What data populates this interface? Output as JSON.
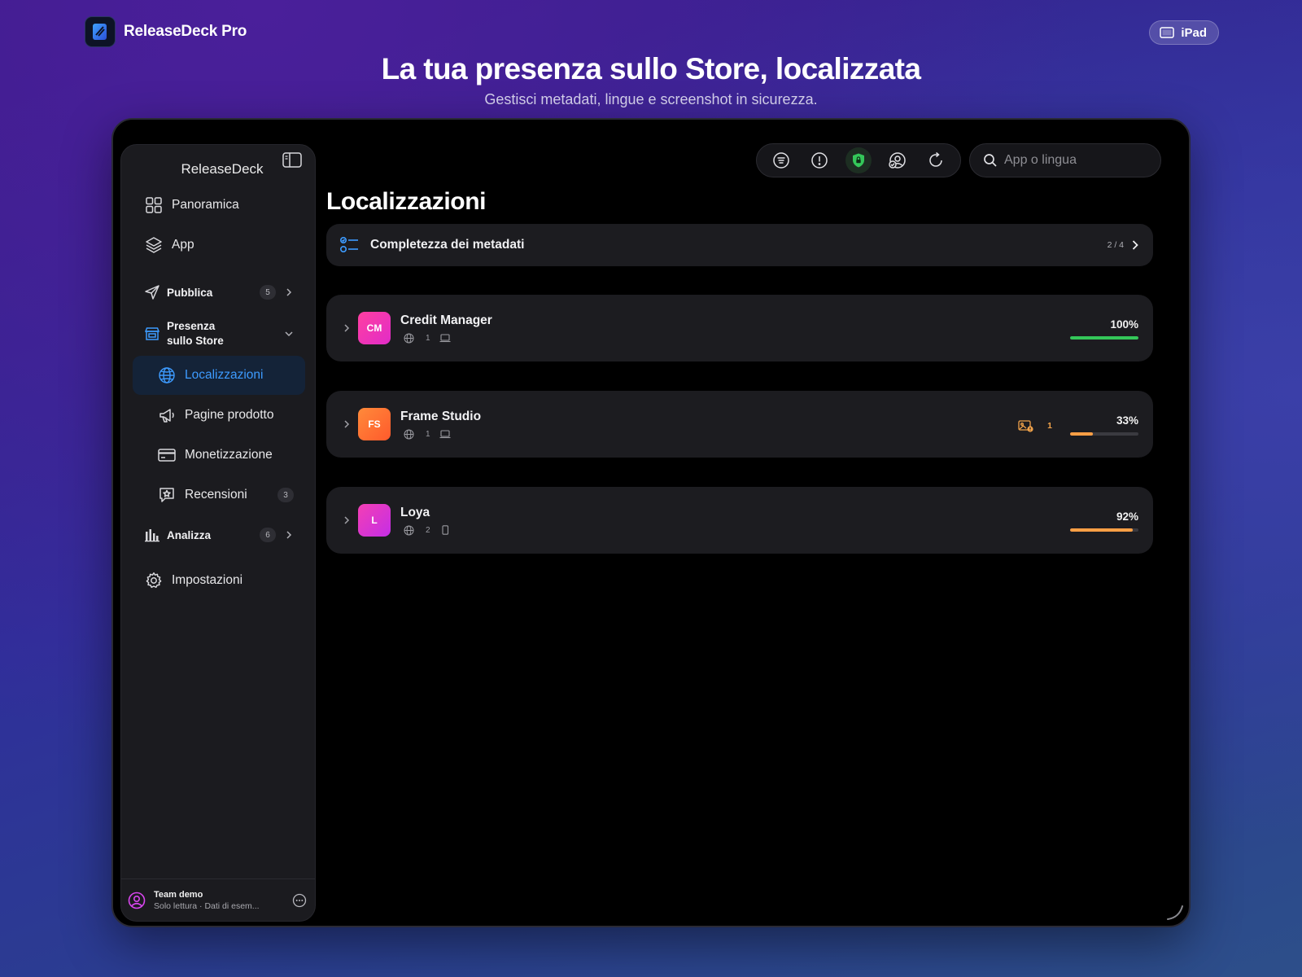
{
  "brand": {
    "name": "ReleaseDeck Pro"
  },
  "device_pill": {
    "label": "iPad"
  },
  "hero": {
    "headline": "La tua presenza sullo Store, localizzata",
    "subline": "Gestisci metadati, lingue e screenshot in sicurezza."
  },
  "sidebar": {
    "title": "ReleaseDeck",
    "items": [
      {
        "label": "Panoramica"
      },
      {
        "label": "App"
      },
      {
        "label": "Pubblica",
        "badge": "5"
      },
      {
        "label_line1": "Presenza",
        "label_line2": "sullo Store"
      },
      {
        "label": "Localizzazioni"
      },
      {
        "label": "Pagine prodotto"
      },
      {
        "label": "Monetizzazione"
      },
      {
        "label": "Recensioni",
        "badge": "3"
      },
      {
        "label": "Analizza",
        "badge": "6"
      },
      {
        "label": "Impostazioni"
      }
    ],
    "footer": {
      "team": "Team demo",
      "subtitle": "Solo lettura · Dati di esem..."
    }
  },
  "search": {
    "placeholder": "App o lingua"
  },
  "main": {
    "title": "Localizzazioni",
    "metadata_card": {
      "label": "Completezza dei metadati",
      "count": "2 / 4"
    },
    "apps": [
      {
        "initials": "CM",
        "name": "Credit Manager",
        "languages": "1",
        "percent_label": "100%",
        "progress": 1.0,
        "bar_color": "#34c759"
      },
      {
        "initials": "FS",
        "name": "Frame Studio",
        "languages": "1",
        "warnings": "1",
        "percent_label": "33%",
        "progress": 0.33,
        "bar_color": "#ff9f45"
      },
      {
        "initials": "L",
        "name": "Loya",
        "languages": "2",
        "percent_label": "92%",
        "progress": 0.92,
        "bar_color": "#ff9f45"
      }
    ]
  },
  "colors": {
    "accent": "#3d9bff",
    "success": "#34c759",
    "warning": "#ff9f45"
  }
}
